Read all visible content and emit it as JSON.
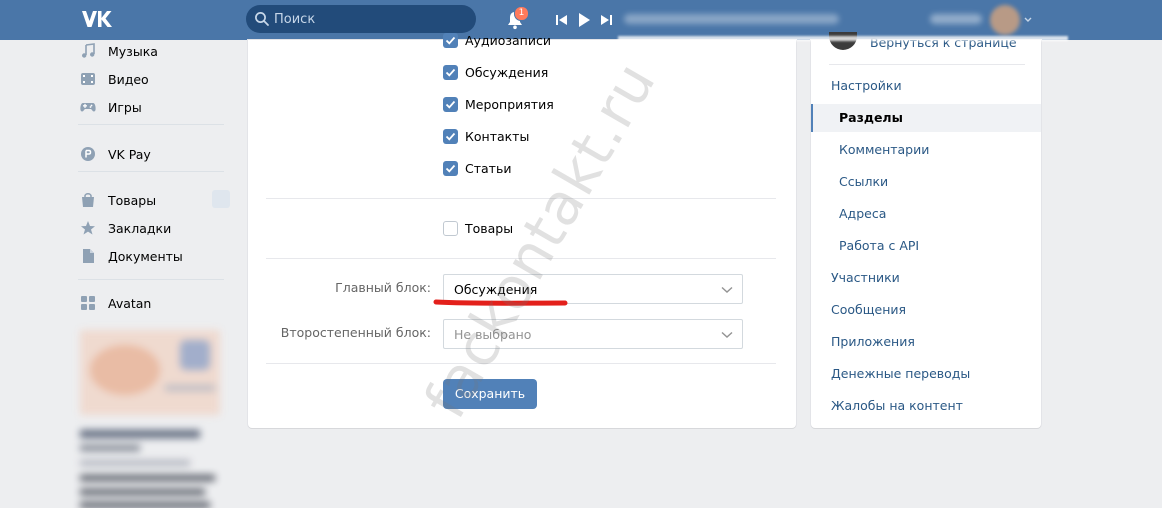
{
  "header": {
    "search_placeholder": "Поиск",
    "notifications_count": "1"
  },
  "leftnav": {
    "items": [
      {
        "label": "Музыка",
        "icon": "music-icon"
      },
      {
        "label": "Видео",
        "icon": "video-icon"
      },
      {
        "label": "Игры",
        "icon": "gamepad-icon"
      },
      {
        "label": "VK Pay",
        "icon": "vkpay-icon"
      },
      {
        "label": "Товары",
        "icon": "shopping-bag-icon"
      },
      {
        "label": "Закладки",
        "icon": "star-icon"
      },
      {
        "label": "Документы",
        "icon": "document-icon"
      },
      {
        "label": "Avatan",
        "icon": "app-grid-icon"
      }
    ]
  },
  "main": {
    "checkboxes": [
      {
        "label": "Аудиозаписи",
        "checked": true
      },
      {
        "label": "Обсуждения",
        "checked": true
      },
      {
        "label": "Мероприятия",
        "checked": true
      },
      {
        "label": "Контакты",
        "checked": true
      },
      {
        "label": "Статьи",
        "checked": true
      }
    ],
    "goods_checkbox": {
      "label": "Товары",
      "checked": false
    },
    "primary_block": {
      "label": "Главный блок:",
      "value": "Обсуждения"
    },
    "secondary_block": {
      "label": "Второстепенный блок:",
      "value": "Не выбрано"
    },
    "save_label": "Сохранить"
  },
  "right": {
    "back_link": "Вернуться к странице",
    "menu": [
      {
        "label": "Настройки",
        "level": "top"
      },
      {
        "label": "Разделы",
        "level": "sub",
        "active": true
      },
      {
        "label": "Комментарии",
        "level": "sub"
      },
      {
        "label": "Ссылки",
        "level": "sub"
      },
      {
        "label": "Адреса",
        "level": "sub"
      },
      {
        "label": "Работа с API",
        "level": "sub"
      },
      {
        "label": "Участники",
        "level": "top"
      },
      {
        "label": "Сообщения",
        "level": "top"
      },
      {
        "label": "Приложения",
        "level": "top"
      },
      {
        "label": "Денежные переводы",
        "level": "top"
      },
      {
        "label": "Жалобы на контент",
        "level": "top"
      }
    ]
  },
  "watermark": "fackontakt.ru",
  "colors": {
    "header_bg": "#4a76a8",
    "accent": "#5181b8",
    "link": "#2a5885",
    "highlight_red": "#e3201b"
  }
}
